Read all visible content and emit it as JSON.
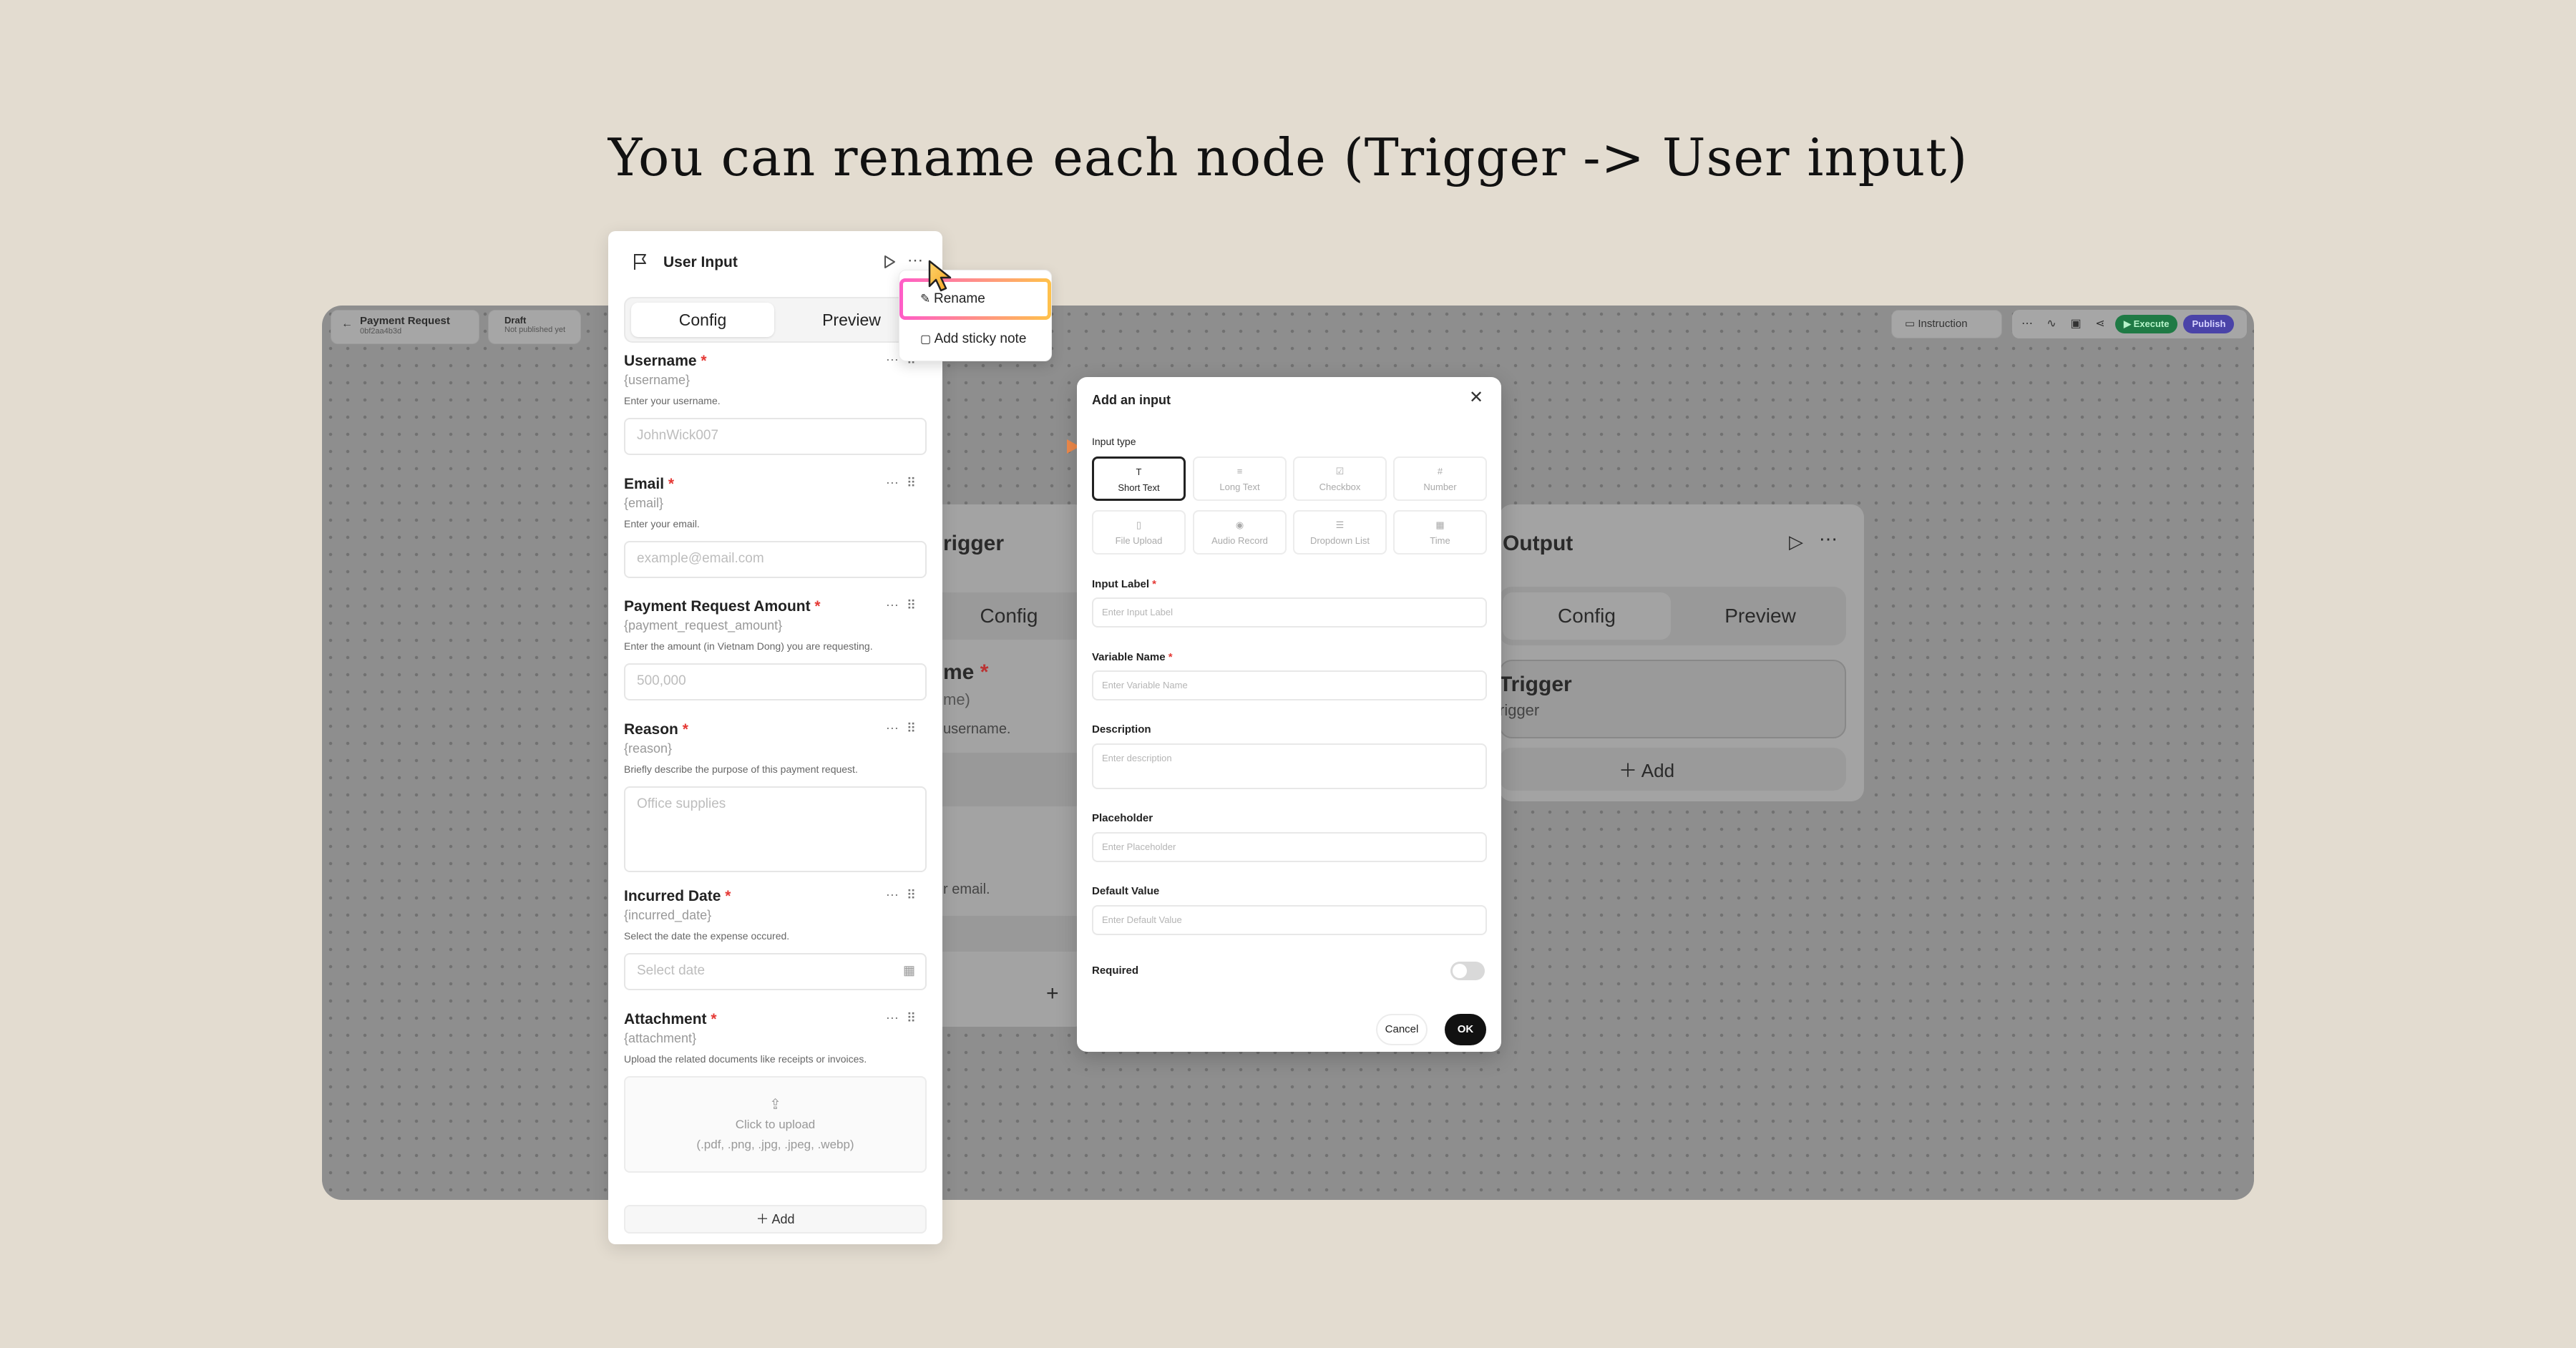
{
  "headline": "You can rename each node (Trigger -> User input)",
  "app_bar": {
    "workflow_name": "Payment Request",
    "workflow_id": "0bf2aa4b3d",
    "status": "Draft",
    "status_sub": "Not published yet",
    "instruction_label": "Instruction",
    "execute_label": "Execute",
    "publish_label": "Publish"
  },
  "background_nodes": {
    "trigger_title": "rigger",
    "trigger_tab_config": "Config",
    "trigger_field_label": "me",
    "trigger_field_var": "me)",
    "trigger_field_desc": "username.",
    "trigger_email_desc": "r email.",
    "output_title": "Output",
    "output_tab_config": "Config",
    "output_tab_preview": "Preview",
    "output_card_title": "Trigger",
    "output_card_sub": "rigger",
    "output_add": "Add"
  },
  "panel": {
    "title": "User Input",
    "tabs": [
      "Config",
      "Preview"
    ],
    "fields": [
      {
        "label": "Username",
        "var": "{username}",
        "desc": "Enter your username.",
        "placeholder": "JohnWick007"
      },
      {
        "label": "Email",
        "var": "{email}",
        "desc": "Enter your email.",
        "placeholder": "example@email.com"
      },
      {
        "label": "Payment Request Amount",
        "var": "{payment_request_amount}",
        "desc": "Enter the amount (in Vietnam Dong) you are requesting.",
        "placeholder": "500,000"
      },
      {
        "label": "Reason",
        "var": "{reason}",
        "desc": "Briefly describe the purpose of this payment request.",
        "placeholder": "Office supplies"
      },
      {
        "label": "Incurred Date",
        "var": "{incurred_date}",
        "desc": "Select the date the expense occured.",
        "placeholder": "Select date"
      },
      {
        "label": "Attachment",
        "var": "{attachment}",
        "desc": "Upload the related documents like receipts or invoices.",
        "upload_line1": "Click to upload",
        "upload_line2": "(.pdf, .png, .jpg, .jpeg, .webp)"
      }
    ],
    "add_label": "Add"
  },
  "context_menu": {
    "items": [
      "Rename",
      "Add sticky note"
    ]
  },
  "modal": {
    "title": "Add an input",
    "input_type_label": "Input type",
    "types": [
      "Short Text",
      "Long Text",
      "Checkbox",
      "Number",
      "File Upload",
      "Audio Record",
      "Dropdown List",
      "Time"
    ],
    "selected_type": "Short Text",
    "input_label": "Input Label",
    "input_label_ph": "Enter Input Label",
    "variable_name": "Variable Name",
    "variable_name_ph": "Enter Variable Name",
    "description": "Description",
    "description_ph": "Enter description",
    "placeholder": "Placeholder",
    "placeholder_ph": "Enter Placeholder",
    "default_value": "Default Value",
    "default_value_ph": "Enter Default Value",
    "required": "Required",
    "required_on": false,
    "cancel": "Cancel",
    "ok": "OK"
  },
  "colors": {
    "page_bg": "#e3dcd0",
    "highlight_start": "#ff5cc8",
    "highlight_end": "#ffc24a",
    "arrow_start": "#a06cf0",
    "arrow_end": "#f08a4b",
    "execute_green": "#1f9d55",
    "publish_purple": "#5b4fd6"
  }
}
